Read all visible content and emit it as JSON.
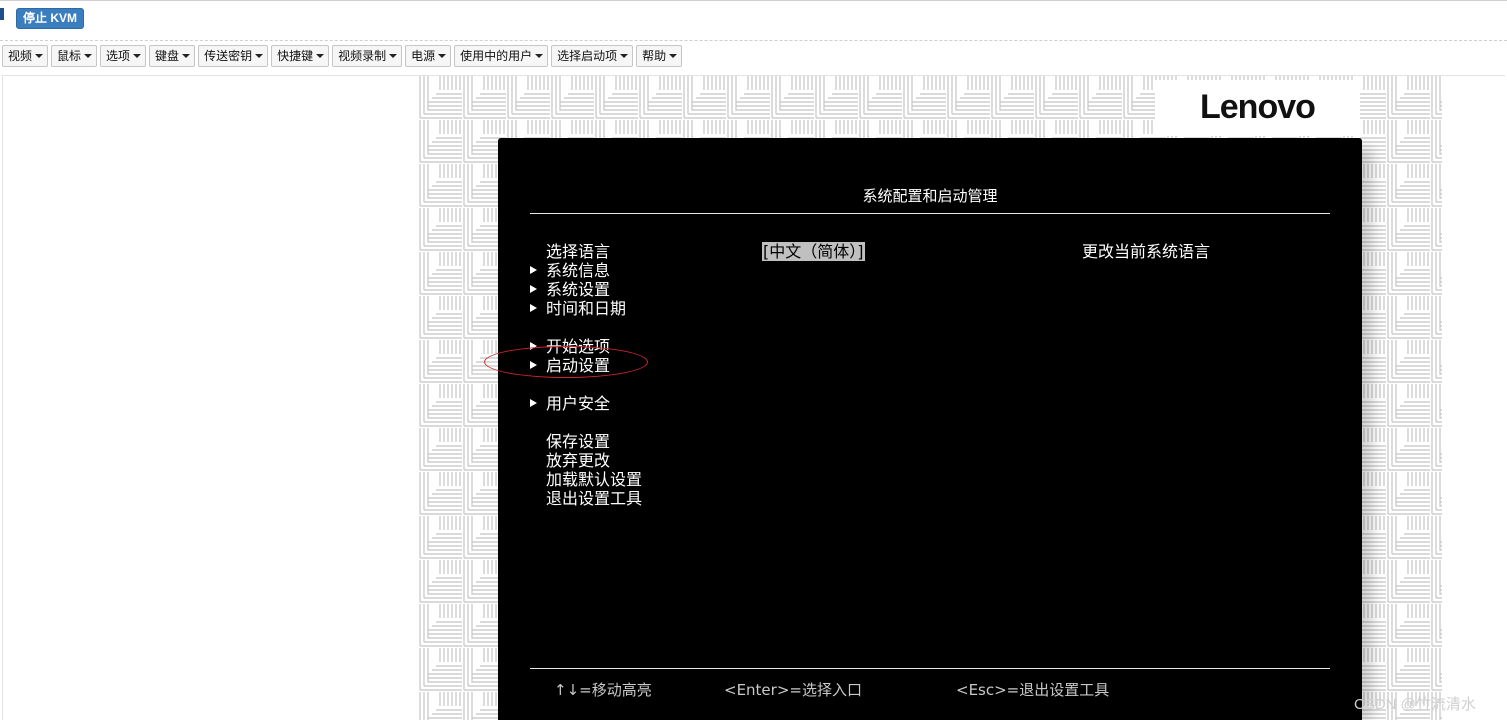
{
  "header": {
    "stop_kvm_label": "停止 KVM"
  },
  "toolbar": {
    "menus": [
      {
        "label": "视频"
      },
      {
        "label": "鼠标"
      },
      {
        "label": "选项"
      },
      {
        "label": "键盘"
      },
      {
        "label": "传送密钥"
      },
      {
        "label": "快捷键"
      },
      {
        "label": "视频录制"
      },
      {
        "label": "电源"
      },
      {
        "label": "使用中的用户"
      },
      {
        "label": "选择启动项"
      },
      {
        "label": "帮助"
      }
    ]
  },
  "brand": {
    "logo_text": "Lenovo"
  },
  "bios": {
    "title": "系统配置和启动管理",
    "language_label": "选择语言",
    "language_value": "[中文（简体）]",
    "language_help": "更改当前系统语言",
    "items": [
      {
        "label": "系统信息",
        "submenu": true
      },
      {
        "label": "系统设置",
        "submenu": true
      },
      {
        "label": "时间和日期",
        "submenu": true
      },
      {
        "label": "开始选项",
        "submenu": true
      },
      {
        "label": "启动设置",
        "submenu": true
      },
      {
        "label": "用户安全",
        "submenu": true
      },
      {
        "label": "保存设置",
        "submenu": false
      },
      {
        "label": "放弃更改",
        "submenu": false
      },
      {
        "label": "加载默认设置",
        "submenu": false
      },
      {
        "label": "退出设置工具",
        "submenu": false
      }
    ],
    "footer": {
      "move": "↑↓=移动高亮",
      "enter": "<Enter>=选择入口",
      "esc": "<Esc>=退出设置工具"
    }
  },
  "watermark": "CSDN @竹流清水"
}
